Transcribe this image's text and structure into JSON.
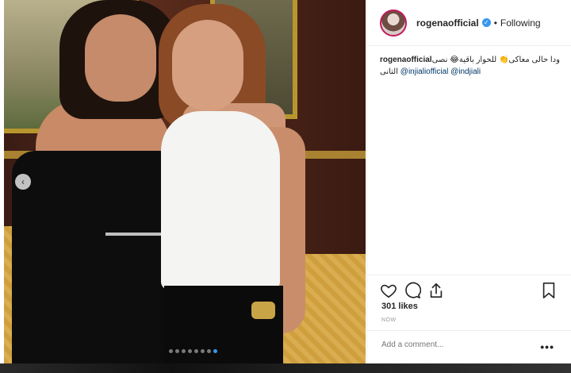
{
  "post": {
    "username": "rogenaofficial",
    "follow_state": "Following",
    "dot": "•",
    "verified_glyph": "✓",
    "caption_user": "rogenaofficial",
    "caption_text": " ودا حالى معاكى👏 للحوار باقية😂 نصى ",
    "caption_text2": " التانى ",
    "mention1": "@injialiofficial",
    "mention2": "@indjiali",
    "likes": "301 likes",
    "time": "NOW",
    "comment_placeholder": "Add a comment...",
    "more_glyph": "•••",
    "prev_glyph": "‹"
  },
  "carousel": {
    "count": 8,
    "active_index": 7
  },
  "colors": {
    "accent": "#3897f0",
    "verified": "#3897f0",
    "text": "#262626",
    "muted": "#999999"
  },
  "icons": [
    "heart-icon",
    "comment-icon",
    "share-icon",
    "bookmark-icon",
    "more-icon",
    "chevron-left-icon"
  ]
}
